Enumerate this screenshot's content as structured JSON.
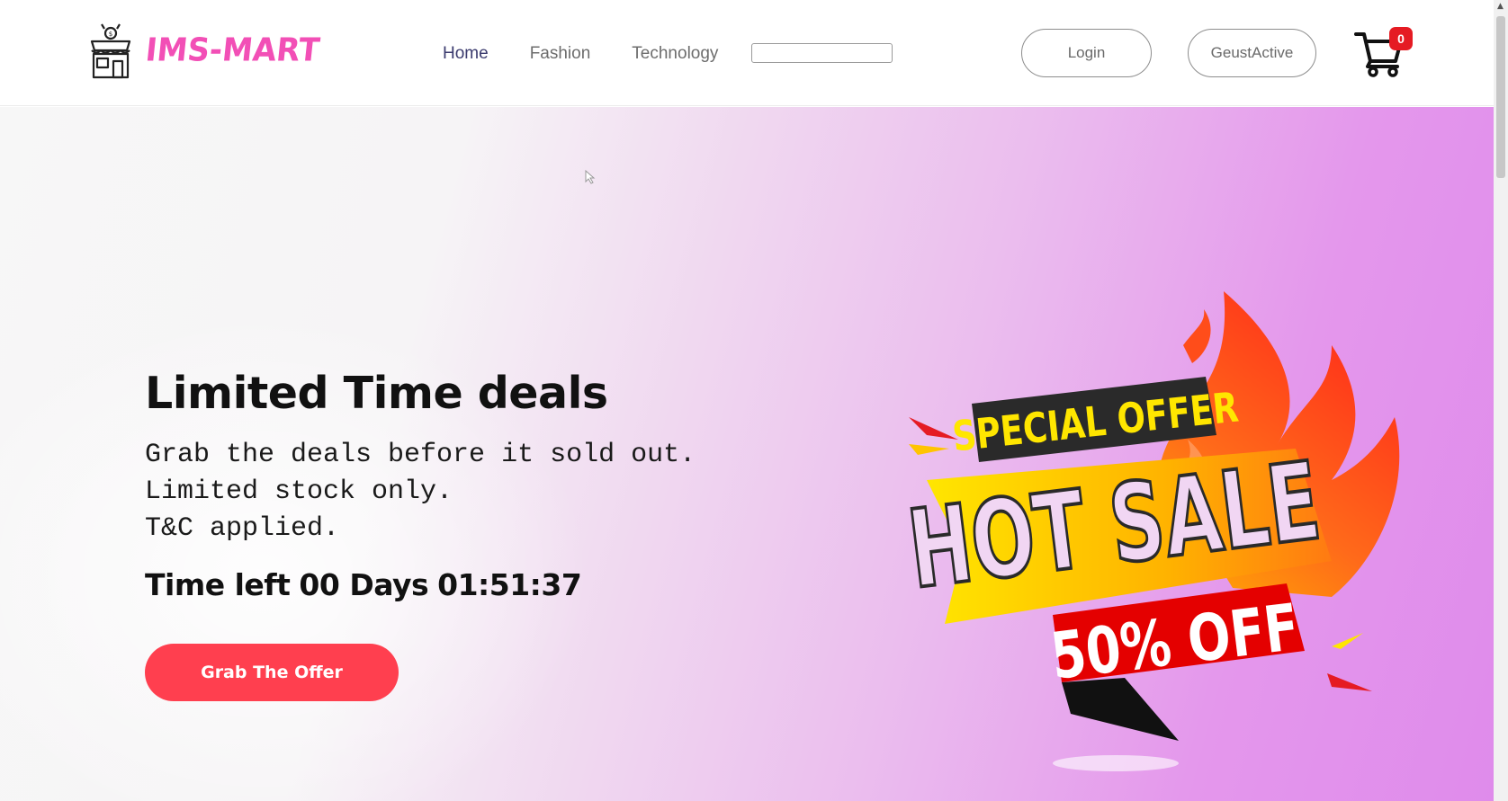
{
  "header": {
    "brand": {
      "name": "IMS-MART",
      "logo_icon": "storefront-icon"
    },
    "nav": [
      {
        "label": "Home",
        "active": true
      },
      {
        "label": "Fashion",
        "active": false
      },
      {
        "label": "Technology",
        "active": false
      }
    ],
    "search": {
      "value": "",
      "placeholder": ""
    },
    "login_label": "Login",
    "guest_label": "GeustActive",
    "cart": {
      "icon": "cart-icon",
      "count": "0"
    }
  },
  "hero": {
    "title": "Limited Time deals",
    "lines": [
      "Grab the deals before it sold out.",
      "Limited stock only.",
      "T&C applied."
    ],
    "timer": {
      "prefix": "Time left",
      "days": "00 Days",
      "clock": "01:51:37"
    },
    "cta_label": "Grab The Offer",
    "badge": {
      "ribbon_top": "SPECIAL OFFER",
      "headline": "HOT SALE",
      "ribbon_bottom": "50% OFF"
    }
  },
  "colors": {
    "brand": "#f24fb6",
    "cta": "#ff3f4f",
    "badge_red": "#e51b23",
    "hero_gradient_end": "#df8beb"
  }
}
